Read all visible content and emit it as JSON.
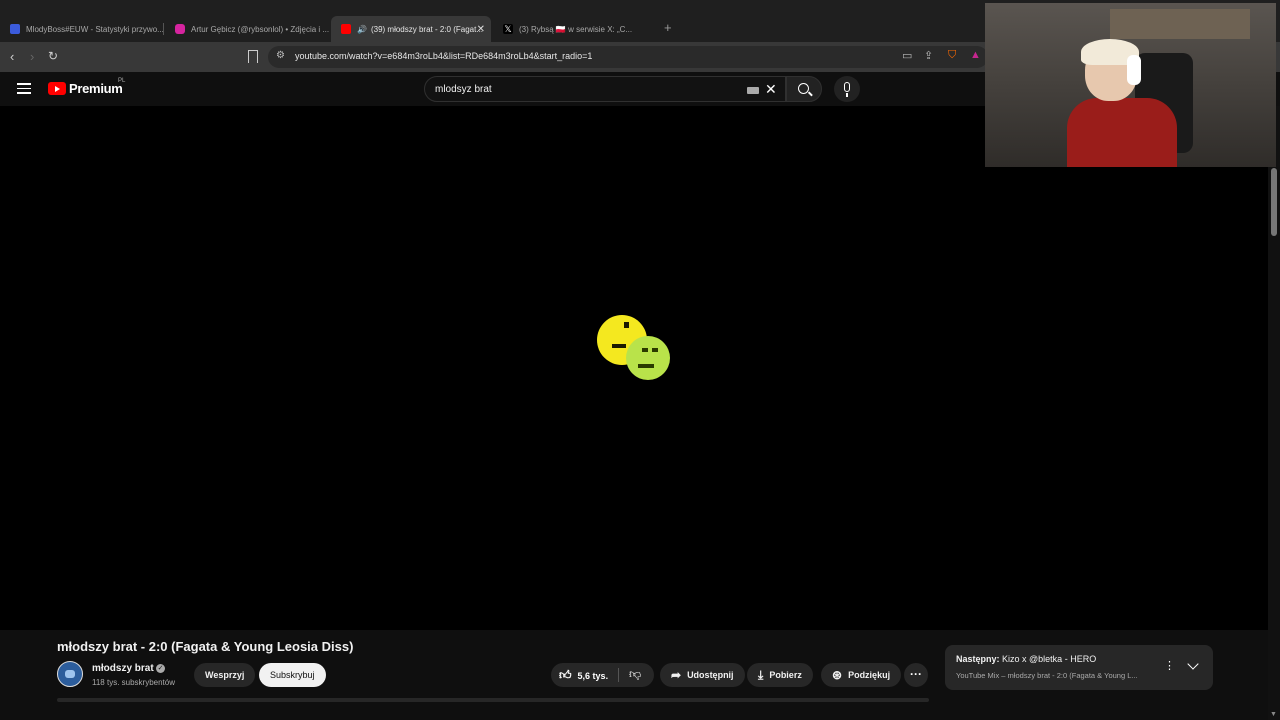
{
  "browser": {
    "tabs": [
      {
        "title": "MlodyBoss#EUW - Statystyki przywo...",
        "favicon_color": "#3b5bdb",
        "active": false
      },
      {
        "title": "Artur Gębicz (@rybsonlol) • Zdjęcia i ...",
        "favicon_color": "#d6249f",
        "active": false
      },
      {
        "title": "(39) młodszy brat - 2:0 (Fagat...",
        "favicon_color": "#ff0000",
        "active": true
      },
      {
        "title": "(3) Rybsą 🇵🇱 w serwisie X: „C...",
        "favicon_color": "#000000",
        "active": false
      }
    ],
    "new_tab": "+",
    "url": "youtube.com/watch?v=e684m3roLb4&list=RDe684m3roLb4&start_radio=1"
  },
  "youtube": {
    "logo_text": "Premium",
    "country_code": "PL",
    "search_query": "mlodsyz brat"
  },
  "video": {
    "title": "młodszy brat - 2:0 (Fagata & Young Leosia Diss)",
    "channel_name": "młodszy brat",
    "subscribers": "118 tys. subskrybentów",
    "support_label": "Wesprzyj",
    "subscribe_label": "Subskrybuj",
    "likes": "5,6 tys.",
    "share_label": "Udostępnij",
    "download_label": "Pobierz",
    "thanks_label": "Podziękuj"
  },
  "up_next": {
    "prefix": "Następny:",
    "title": "Kizo x @bletka - HERO",
    "subtitle": "YouTube Mix – młodszy brat - 2:0 (Fagata & Young L..."
  },
  "colors": {
    "background": "#0f0f0f",
    "accent_red": "#ff0000",
    "pill": "#272727"
  }
}
